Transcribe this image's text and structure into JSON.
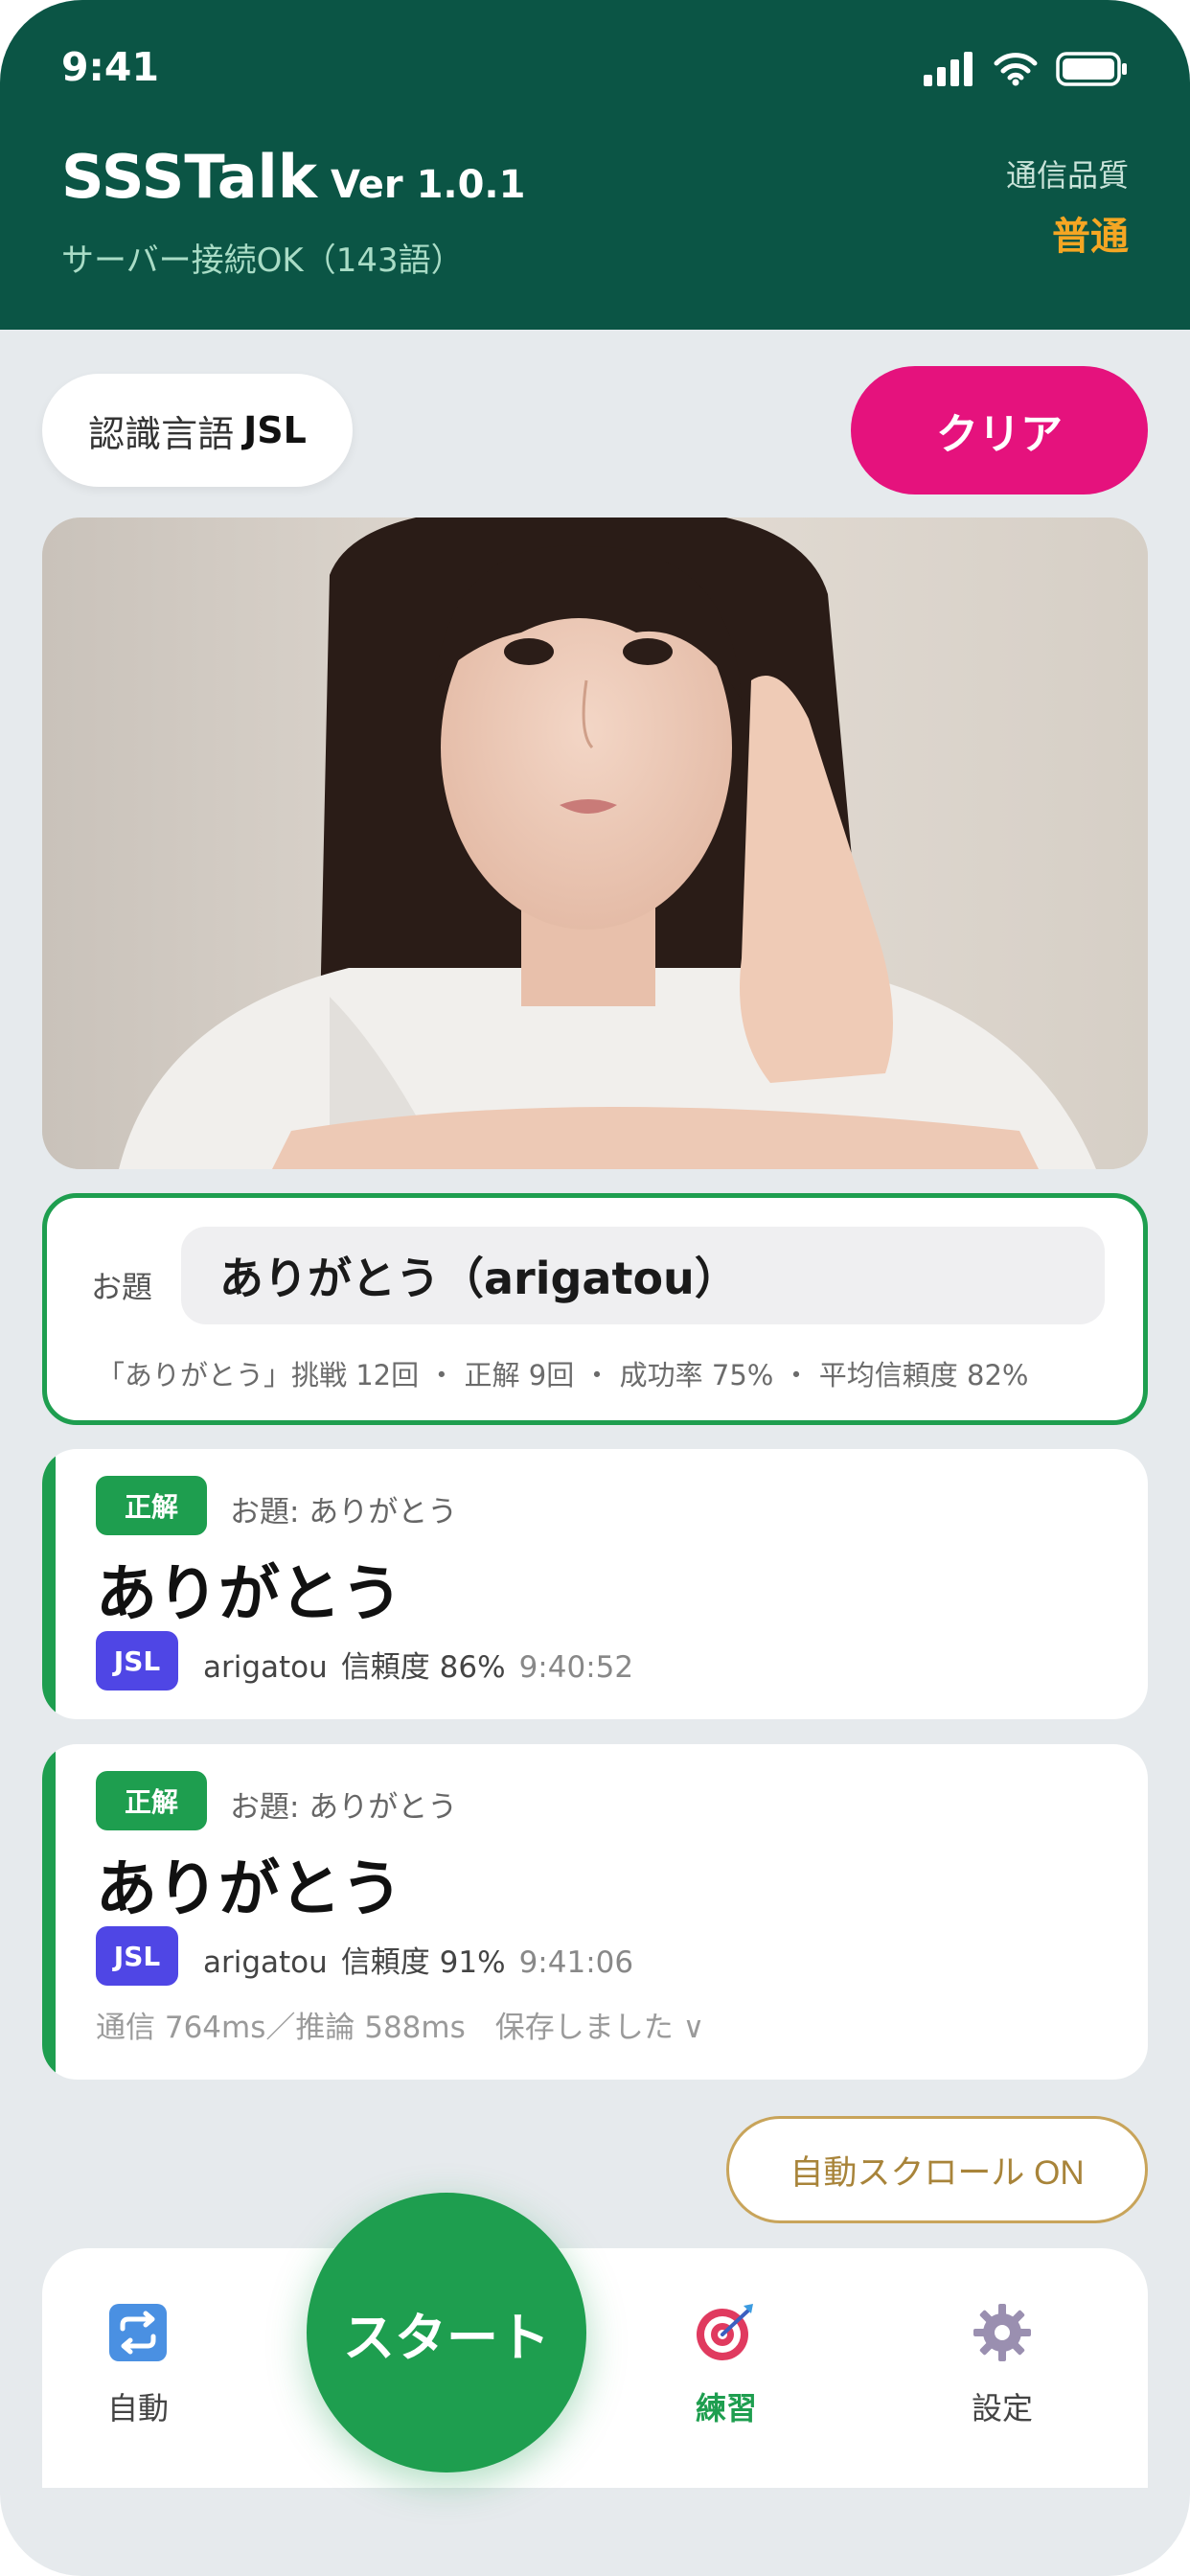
{
  "status_bar": {
    "time": "9:41"
  },
  "header": {
    "app_name": "SSSTalk",
    "version": "Ver 1.0.1",
    "server_status": "サーバー接続OK（143語）",
    "quality_label": "通信品質",
    "quality_value": "普通"
  },
  "controls": {
    "language_label": "認識言語",
    "language_value": "JSL",
    "clear_label": "クリア"
  },
  "topic": {
    "label": "お題",
    "value": "ありがとう（arigatou）",
    "stats": "「ありがとう」挑戦 12回 ・ 正解 9回 ・ 成功率 75% ・ 平均信頼度 82%"
  },
  "results": [
    {
      "badge": "正解",
      "prompt": "お題: ありがとう",
      "word": "ありがとう",
      "lang": "JSL",
      "romaji": "arigatou",
      "confidence": "信頼度 86%",
      "time": "9:40:52"
    },
    {
      "badge": "正解",
      "prompt": "お題: ありがとう",
      "word": "ありがとう",
      "lang": "JSL",
      "romaji": "arigatou",
      "confidence": "信頼度 91%",
      "time": "9:41:06",
      "extra": "通信 764ms／推論 588ms　保存しました ∨"
    }
  ],
  "autoscroll_label": "自動スクロール ON",
  "start_label": "スタート",
  "nav": {
    "auto_label": "自動",
    "practice_label": "練習",
    "settings_label": "設定",
    "active": "practice"
  },
  "colors": {
    "header_bg": "#0b5545",
    "accent_green": "#1e9e4f",
    "clear_pink": "#e5127d",
    "jsl_purple": "#4f46e5",
    "quality_orange": "#f5a623"
  }
}
